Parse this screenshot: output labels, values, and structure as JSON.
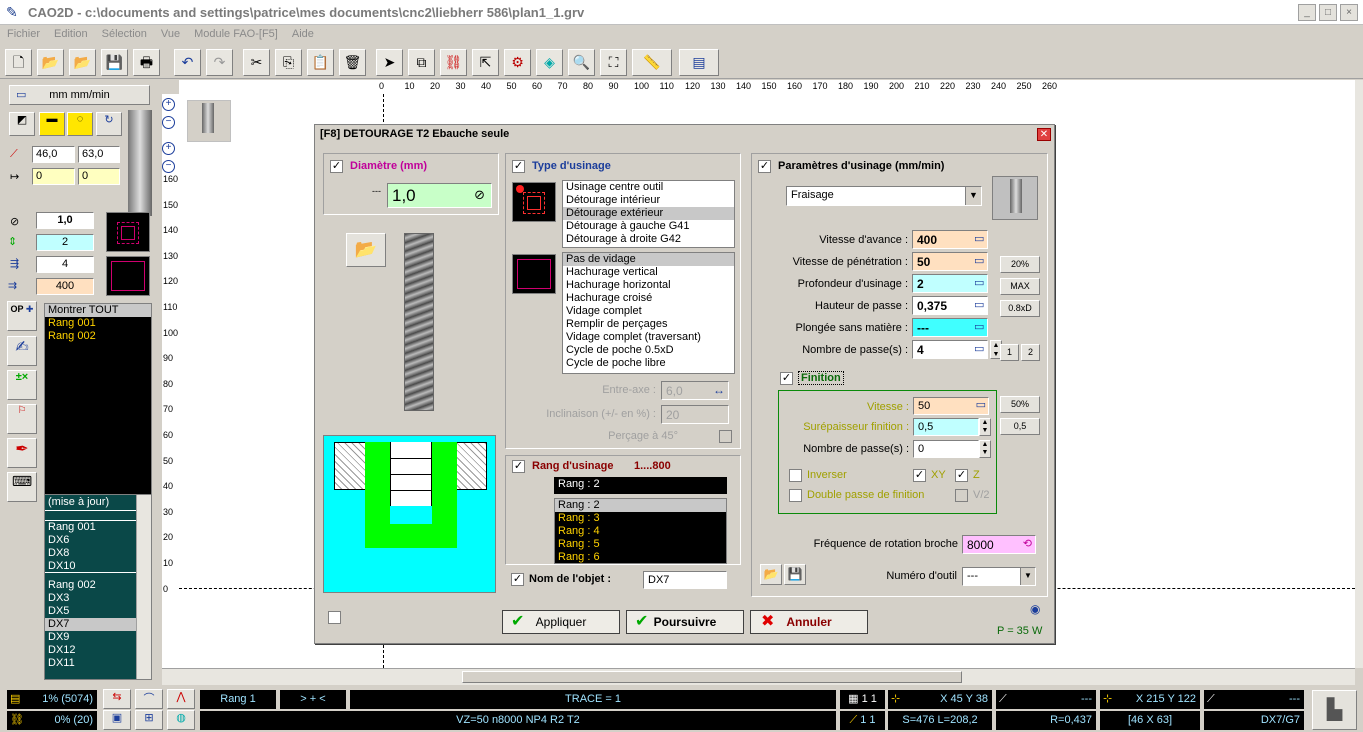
{
  "app": {
    "title": "CAO2D - c:\\documents and settings\\patrice\\mes documents\\cnc2\\liebherr 586\\plan1_1.grv"
  },
  "menu": [
    "Fichier",
    "Edition",
    "Sélection",
    "Vue",
    "Module FAO-[F5]",
    "Aide"
  ],
  "window_buttons": {
    "minimize": "_",
    "maximize": "□",
    "close": "×"
  },
  "left": {
    "units_label": "mm  mm/min",
    "coord_a": "46,0",
    "coord_b": "63,0",
    "offset_a": "0",
    "offset_b": "0",
    "tool_diameter": "1,0",
    "depth": "2",
    "passes": "4",
    "feed": "400",
    "op_label": "OP",
    "layers": [
      "Montrer TOUT",
      "Rang 001",
      "Rang 002"
    ],
    "objects_header": "(mise à jour)",
    "objects": [
      "Rang 001",
      "DX6",
      "DX8",
      "DX10",
      "Rang 002",
      "DX3",
      "DX5",
      "DX7",
      "DX9",
      "DX12",
      "DX11"
    ]
  },
  "ruler": {
    "top": [
      "0",
      "10",
      "20",
      "30",
      "40",
      "50",
      "60",
      "70",
      "80",
      "90",
      "100",
      "110",
      "120",
      "130",
      "140",
      "150",
      "160",
      "170",
      "180",
      "190",
      "200",
      "210",
      "220",
      "230",
      "240",
      "250",
      "260"
    ],
    "left": [
      "160",
      "150",
      "140",
      "130",
      "120",
      "110",
      "100",
      "90",
      "80",
      "70",
      "60",
      "50",
      "40",
      "30",
      "20",
      "10",
      "0"
    ]
  },
  "dialog": {
    "title": "[F8] DETOURAGE T2 Ebauche seule",
    "diameter": {
      "label": "Diamètre (mm)",
      "value": "1,0"
    },
    "usinage_type": {
      "label": "Type d'usinage",
      "modes": [
        "Usinage centre outil",
        "Détourage intérieur",
        "Détourage extérieur",
        "Détourage à gauche G41",
        "Détourage à droite G42"
      ],
      "selected_mode": 2,
      "fills": [
        "Pas de vidage",
        "Hachurage vertical",
        "Hachurage horizontal",
        "Hachurage croisé",
        "Vidage complet",
        "Remplir de perçages",
        "Vidage complet (traversant)",
        "Cycle de poche 0.5xD",
        "Cycle de poche libre"
      ],
      "selected_fill": 0,
      "entraxe_label": "Entre-axe :",
      "entraxe_value": "6,0",
      "inclinaison_label": "Inclinaison (+/- en %) :",
      "inclinaison_value": "20",
      "percage_label": "Perçage à 45°"
    },
    "rang": {
      "label": "Rang d'usinage",
      "range": "1....800",
      "current": "Rang : 2",
      "items": [
        "Rang : 2",
        "Rang : 3",
        "Rang : 4",
        "Rang : 5",
        "Rang : 6"
      ]
    },
    "object_name": {
      "label": "Nom de l'objet :",
      "value": "DX7"
    },
    "params": {
      "label": "Paramètres d'usinage (mm/min)",
      "mode": "Fraisage",
      "rows": [
        {
          "label": "Vitesse d'avance :",
          "value": "400",
          "color": "#ffe0c0"
        },
        {
          "label": "Vitesse de pénétration :",
          "value": "50",
          "color": "#ffe0c0"
        },
        {
          "label": "Profondeur d'usinage :",
          "value": "2",
          "color": "#c0ffff"
        },
        {
          "label": "Hauteur de passe :",
          "value": "0,375",
          "color": "#ffffff"
        },
        {
          "label": "Plongée sans matière :",
          "value": "---",
          "color": "#40ffff"
        },
        {
          "label": "Nombre de passe(s) :",
          "value": "4",
          "color": "#ffffff"
        }
      ],
      "btn_20": "20%",
      "btn_max": "MAX",
      "btn_08xd": "0.8xD",
      "btn_1": "1",
      "btn_2": "2"
    },
    "finition": {
      "label": "Finition",
      "vitesse_label": "Vitesse :",
      "vitesse_value": "50",
      "surep_label": "Surépaisseur finition :",
      "surep_value": "0,5",
      "passes_label": "Nombre de passe(s) :",
      "passes_value": "0",
      "btn_50": "50%",
      "btn_05": "0,5",
      "inverser": "Inverser",
      "xy": "XY",
      "z": "Z",
      "double": "Double passe de finition",
      "v2": "V/2"
    },
    "rotation": {
      "label": "Fréquence de rotation broche",
      "value": "8000"
    },
    "tool_num": {
      "label": "Numéro d'outil",
      "value": "---"
    },
    "power": "P = 35 W",
    "buttons": {
      "apply": "Appliquer",
      "continue": "Poursuivre",
      "cancel": "Annuler"
    }
  },
  "status": {
    "pct1": "1% (5074)",
    "pct2": "0% (20)",
    "rang": "Rang 1",
    "arrows": "> + <",
    "trace": "TRACE = 1",
    "vz": "VZ=50  n8000  NP4  R2  T2",
    "grid1": "1 1",
    "grid2": "1 1",
    "xy1": "X 45  Y 38",
    "dash": "---",
    "xy2": "X 215  Y 122",
    "s_l": "S=476 L=208,2",
    "r": "R=0,437",
    "coords": "[46 X 63]",
    "dx": "DX7/G7"
  }
}
